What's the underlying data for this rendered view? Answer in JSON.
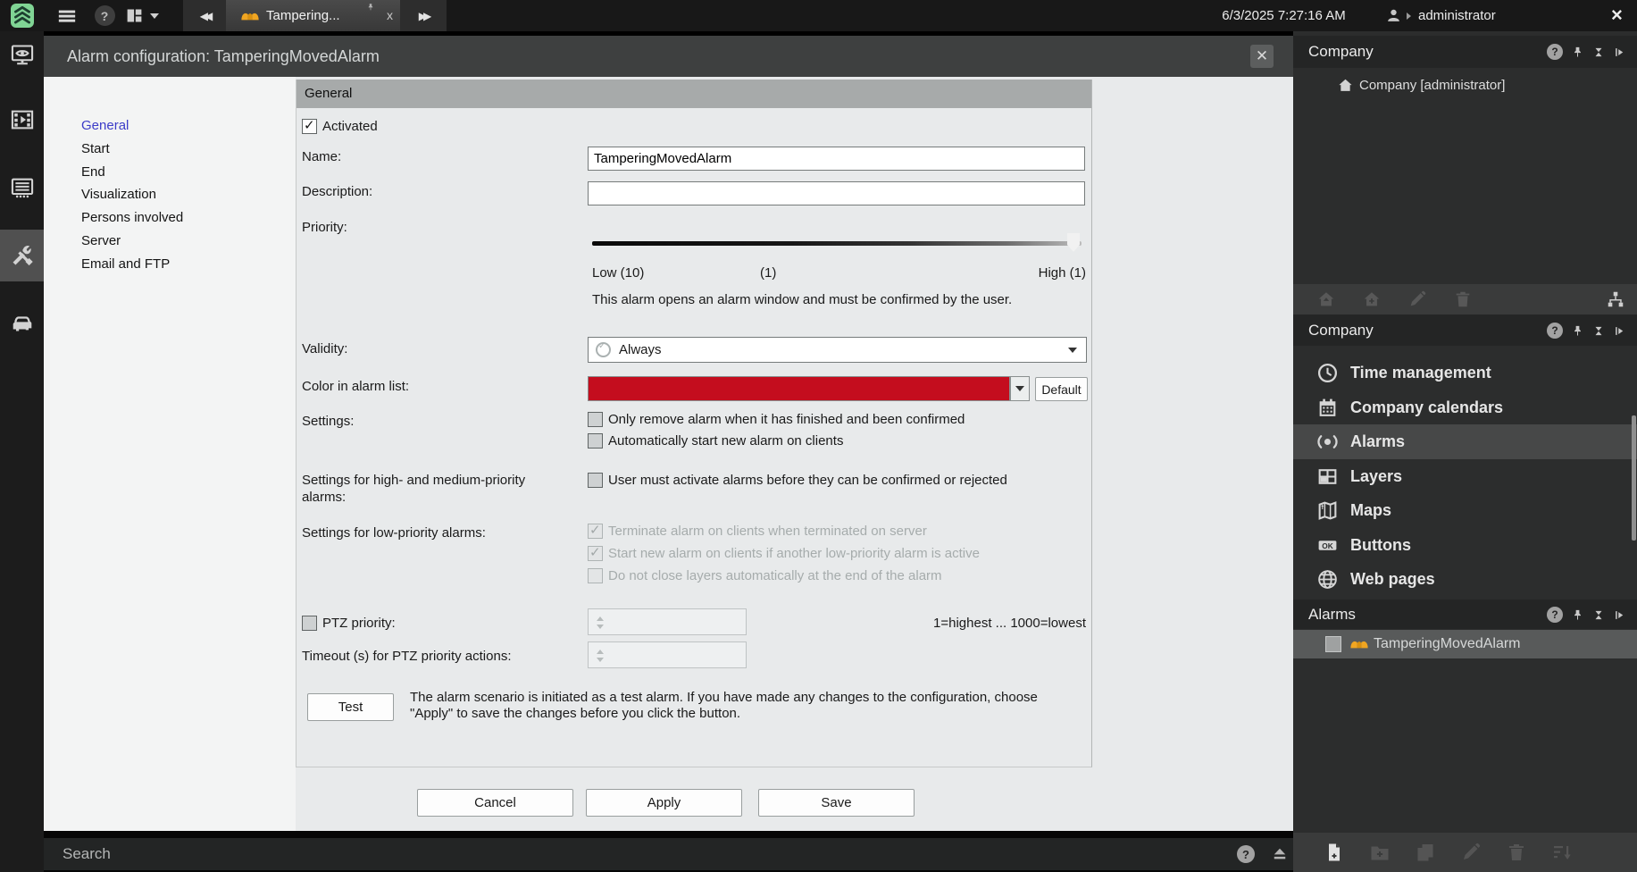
{
  "topbar": {
    "tab": {
      "label": "Tampering..."
    },
    "datetime": "6/3/2025 7:27:16 AM",
    "user": "administrator"
  },
  "dialog": {
    "title": "Alarm configuration: TamperingMovedAlarm",
    "tab": "General",
    "nav": [
      {
        "label": "General"
      },
      {
        "label": "Start"
      },
      {
        "label": "End"
      },
      {
        "label": "Visualization"
      },
      {
        "label": "Persons involved"
      },
      {
        "label": "Server"
      },
      {
        "label": "Email and FTP"
      }
    ],
    "form": {
      "activated": {
        "label": "Activated",
        "checked": true
      },
      "name": {
        "label": "Name:",
        "value": "TamperingMovedAlarm"
      },
      "description": {
        "label": "Description:",
        "value": ""
      },
      "priority": {
        "label": "Priority:",
        "low": "Low (10)",
        "mid": "(1)",
        "high": "High (1)",
        "note": "This alarm opens an alarm window and must be confirmed by the user."
      },
      "validity": {
        "label": "Validity:",
        "value": "Always"
      },
      "color": {
        "label": "Color in alarm list:",
        "value": "#c40d1e",
        "default_button": "Default"
      },
      "settings": {
        "label": "Settings:",
        "options": [
          {
            "label": "Only remove alarm when it has finished and been confirmed",
            "checked": false
          },
          {
            "label": "Automatically start new alarm on clients",
            "checked": false
          }
        ]
      },
      "high_medium": {
        "label": "Settings for high- and medium-priority alarms:",
        "options": [
          {
            "label": "User must activate alarms before they can be confirmed or rejected",
            "checked": false
          }
        ]
      },
      "low_priority": {
        "label": "Settings for low-priority alarms:",
        "options": [
          {
            "label": "Terminate alarm on clients when terminated on server",
            "checked": true,
            "disabled": true
          },
          {
            "label": "Start new alarm on clients if another low-priority alarm is active",
            "checked": true,
            "disabled": true
          },
          {
            "label": "Do not close layers automatically at the end of the alarm",
            "checked": false,
            "disabled": true
          }
        ]
      },
      "ptz": {
        "label": "PTZ priority:",
        "checked": false,
        "range_note": "1=highest ... 1000=lowest"
      },
      "timeout": {
        "label": "Timeout (s) for PTZ priority actions:"
      },
      "test": {
        "button": "Test",
        "note": "The alarm scenario is initiated as a test alarm. If you have made any changes to the configuration, choose \"Apply\" to save the changes before you click the button."
      }
    },
    "footer": {
      "cancel": "Cancel",
      "apply": "Apply",
      "save": "Save"
    }
  },
  "statusbar": {
    "search": "Search"
  },
  "right_panel": {
    "section_company_tree": {
      "title": "Company",
      "tree_root": "Company [administrator]"
    },
    "section_company_nav": {
      "title": "Company",
      "items": [
        {
          "label": "Time management",
          "icon": "clock"
        },
        {
          "label": "Company calendars",
          "icon": "calendar"
        },
        {
          "label": "Alarms",
          "icon": "alarm-waves",
          "selected": true
        },
        {
          "label": "Layers",
          "icon": "layers-grid"
        },
        {
          "label": "Maps",
          "icon": "map"
        },
        {
          "label": "Buttons",
          "icon": "ok-button"
        },
        {
          "label": "Web pages",
          "icon": "globe"
        }
      ]
    },
    "section_alarms": {
      "title": "Alarms",
      "item": "TamperingMovedAlarm"
    }
  },
  "colors": {
    "alarm_list_color": "#c40d1e",
    "alarm_icon_orange": "#f0a521",
    "active_nav_blue": "#3c3cc8",
    "logo_green": "#80d494"
  }
}
